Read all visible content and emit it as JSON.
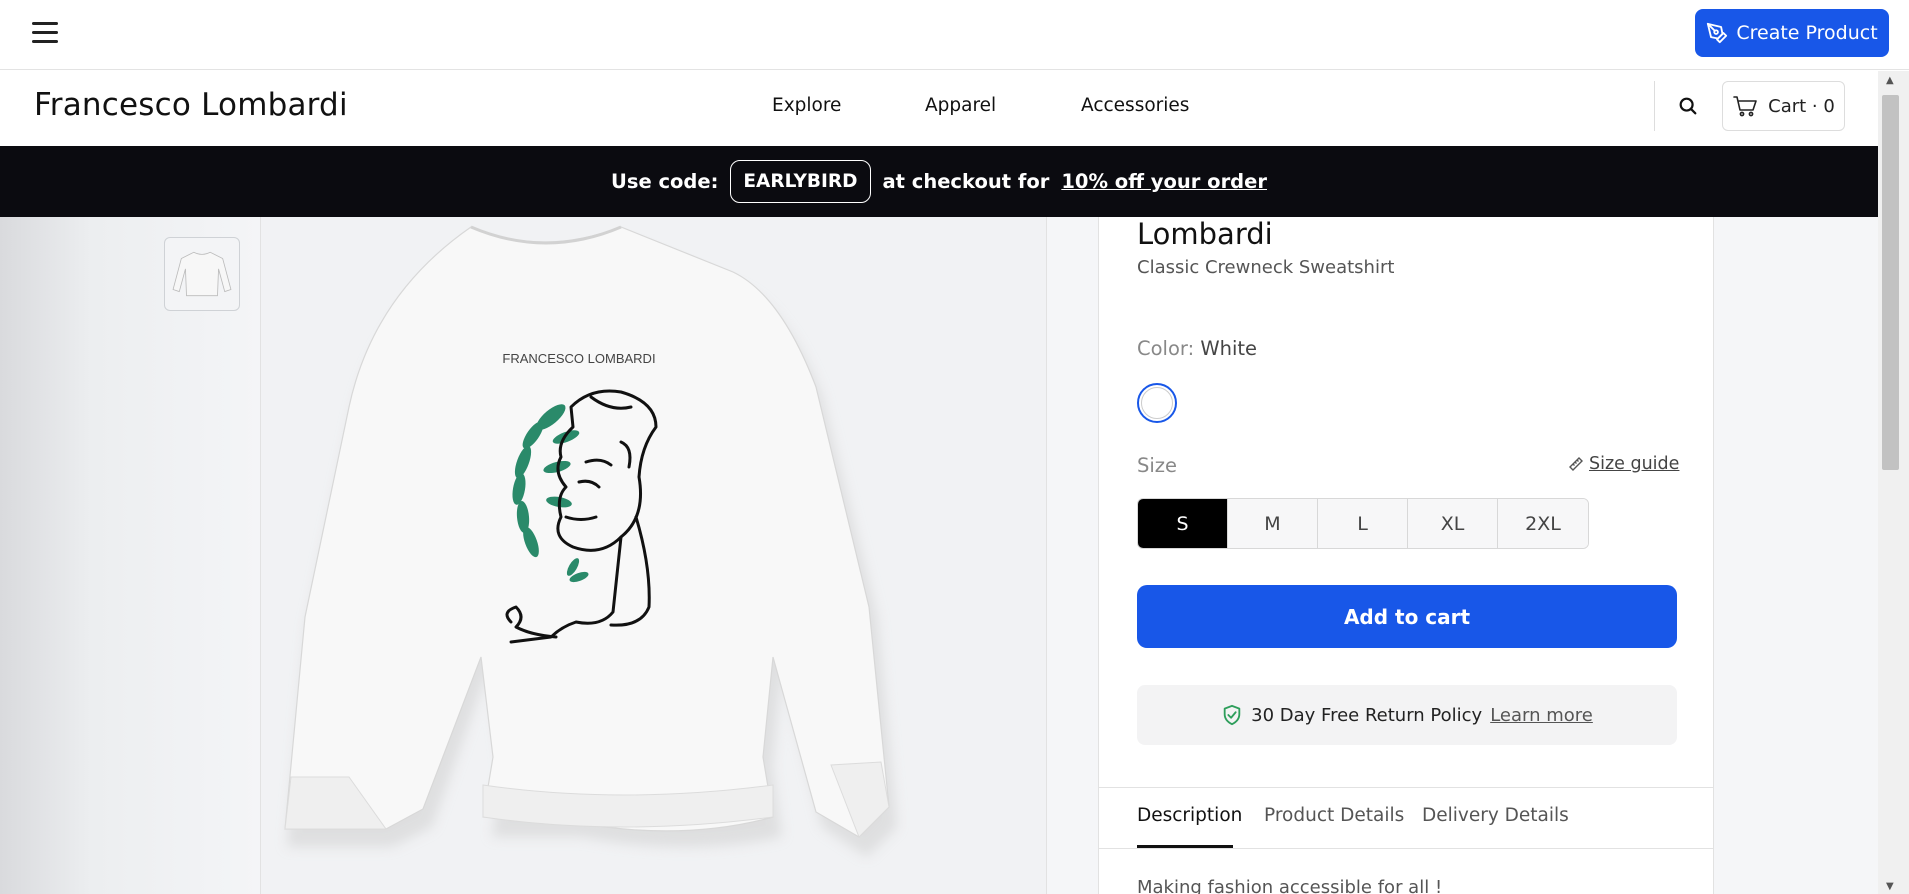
{
  "appbar": {
    "menu_icon": "hamburger-menu-icon",
    "create_label": "Create Product"
  },
  "store": {
    "brand": "Francesco Lombardi",
    "nav": [
      "Explore",
      "Apparel",
      "Accessories"
    ],
    "cart_label": "Cart · 0"
  },
  "promo": {
    "prefix": "Use code:",
    "code": "EARLYBIRD",
    "middle": "at checkout for",
    "offer": "10% off your order"
  },
  "gallery": {
    "print_text": "FRANCESCO LOMBARDI"
  },
  "product": {
    "title": "Lombardi",
    "subtitle": "Classic Crewneck Sweatshirt",
    "color_label": "Color:",
    "color_value": "White",
    "size_label": "Size",
    "size_guide": "Size guide",
    "sizes": [
      "S",
      "M",
      "L",
      "XL",
      "2XL"
    ],
    "selected_size": "S",
    "add_to_cart": "Add to cart",
    "returns_text": "30 Day Free Return Policy",
    "returns_link": "Learn more",
    "tabs": [
      "Description",
      "Product Details",
      "Delivery Details"
    ],
    "description": "Making fashion accessible for all !"
  },
  "colors": {
    "accent": "#1857e8",
    "promo_bg": "#0b0b10",
    "return_icon": "#2e9e5b"
  }
}
